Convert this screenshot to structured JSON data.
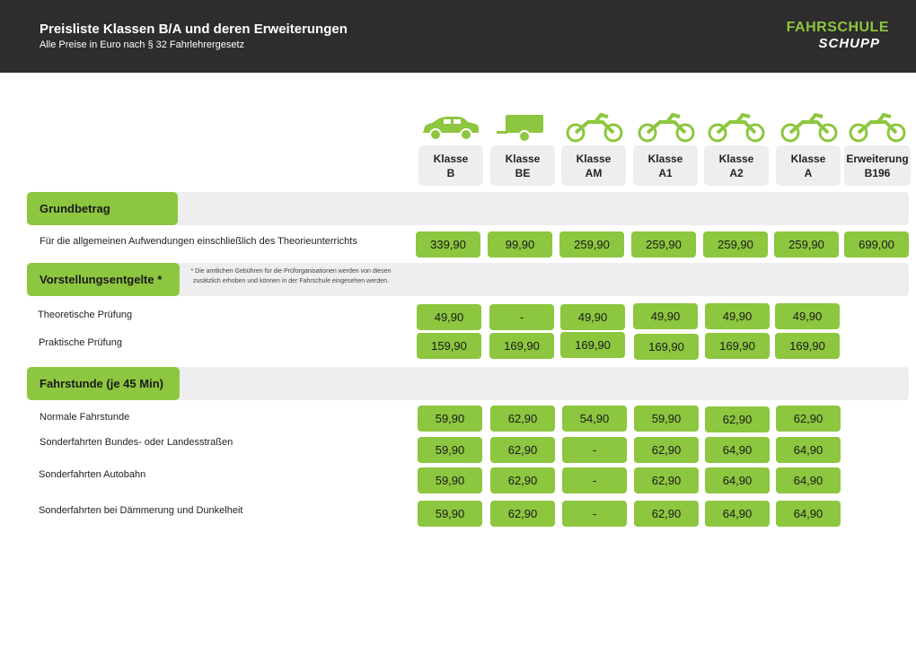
{
  "header": {
    "title": "Preisliste Klassen B/A und deren Erweiterungen",
    "subtitle": "Alle Preise in Euro nach § 32 Fahrlehrergesetz",
    "logo_line1": "FAHRSCHULE",
    "logo_line2": "SCHUPP",
    "accent_color": "#8dc63f",
    "header_color": "#2e2c2c"
  },
  "classes": [
    {
      "line1": "Klasse",
      "line2": "B",
      "icon": "car-icon"
    },
    {
      "line1": "Klasse",
      "line2": "BE",
      "icon": "trailer-icon"
    },
    {
      "line1": "Klasse",
      "line2": "AM",
      "icon": "motorcycle-icon"
    },
    {
      "line1": "Klasse",
      "line2": "A1",
      "icon": "motorcycle-icon"
    },
    {
      "line1": "Klasse",
      "line2": "A2",
      "icon": "motorcycle-icon"
    },
    {
      "line1": "Klasse",
      "line2": "A",
      "icon": "motorcycle-icon"
    },
    {
      "line1": "Erweiterung",
      "line2": "B196",
      "icon": "motorcycle-icon"
    }
  ],
  "sections": {
    "grundbetrag": {
      "label": "Grundbetrag",
      "rows": [
        {
          "label": "Für die allgemeinen Aufwendungen einschließlich des Theorieunterrichts",
          "values": [
            "339,90",
            "99,90",
            "259,90",
            "259,90",
            "259,90",
            "259,90",
            "699,00"
          ]
        }
      ]
    },
    "vorstellung": {
      "label": "Vorstellungsentgelte *",
      "note": "* Die amtlichen Gebühren für die Prüforganisationen werden von diesen zusätzlich erhoben und können in der Fahrschule eingesehen werden.",
      "rows": [
        {
          "label": "Theoretische Prüfung",
          "values": [
            "49,90",
            "-",
            "49,90",
            "49,90",
            "49,90",
            "49,90"
          ]
        },
        {
          "label": "Praktische Prüfung",
          "values": [
            "159,90",
            "169,90",
            "169,90",
            "169,90",
            "169,90",
            "169,90"
          ]
        }
      ]
    },
    "fahrstunde": {
      "label": "Fahrstunde (je 45 Min)",
      "rows": [
        {
          "label": "Normale Fahrstunde",
          "values": [
            "59,90",
            "62,90",
            "54,90",
            "59,90",
            "62,90",
            "62,90"
          ]
        },
        {
          "label": "Sonderfahrten Bundes- oder Landesstraßen",
          "values": [
            "59,90",
            "62,90",
            "-",
            "62,90",
            "64,90",
            "64,90"
          ]
        },
        {
          "label": "Sonderfahrten Autobahn",
          "values": [
            "59,90",
            "62,90",
            "-",
            "62,90",
            "64,90",
            "64,90"
          ]
        },
        {
          "label": "Sonderfahrten bei Dämmerung und Dunkelheit",
          "values": [
            "59,90",
            "62,90",
            "-",
            "62,90",
            "64,90",
            "64,90"
          ]
        }
      ]
    }
  }
}
